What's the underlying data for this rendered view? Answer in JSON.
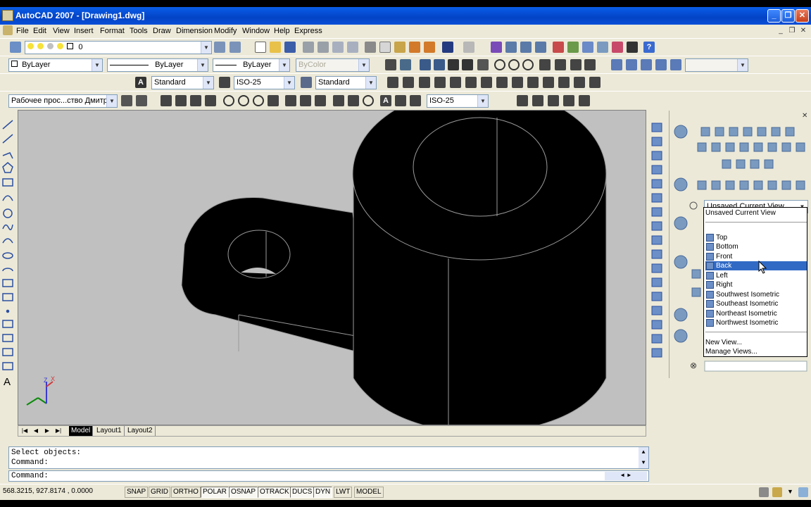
{
  "window": {
    "title": "AutoCAD 2007 - [Drawing1.dwg]"
  },
  "menu": [
    "File",
    "Edit",
    "View",
    "Insert",
    "Format",
    "Tools",
    "Draw",
    "Dimension",
    "Modify",
    "Window",
    "Help",
    "Express"
  ],
  "layers": {
    "current": "0"
  },
  "properties": {
    "color": "ByLayer",
    "linetype": "ByLayer",
    "lineweight": "ByLayer",
    "plotstyle": "ByColor"
  },
  "styles": {
    "text": "Standard",
    "dimension": "ISO-25",
    "table": "Standard"
  },
  "workspace": {
    "current": "Рабочее прос...ство Дмитри",
    "dimstyle": "ISO-25"
  },
  "layout_tabs": [
    "Model",
    "Layout1",
    "Layout2"
  ],
  "views": {
    "current": "Unsaved Current View",
    "header": "Unsaved Current View",
    "items": [
      "Top",
      "Bottom",
      "Front",
      "Back",
      "Left",
      "Right",
      "Southwest Isometric",
      "Southeast Isometric",
      "Northeast Isometric",
      "Northwest Isometric"
    ],
    "selected": "Back",
    "actions": [
      "New View...",
      "Manage Views..."
    ]
  },
  "command": {
    "history": [
      "Select objects:",
      "Command:"
    ],
    "prompt": "Command:"
  },
  "status": {
    "coords": "568.3215, 927.8174 , 0.0000",
    "toggles": [
      "SNAP",
      "GRID",
      "ORTHO",
      "POLAR",
      "OSNAP",
      "OTRACK",
      "DUCS",
      "DYN",
      "LWT",
      "MODEL"
    ]
  },
  "ucs": {
    "x_label": "X",
    "z_label": "Z"
  }
}
